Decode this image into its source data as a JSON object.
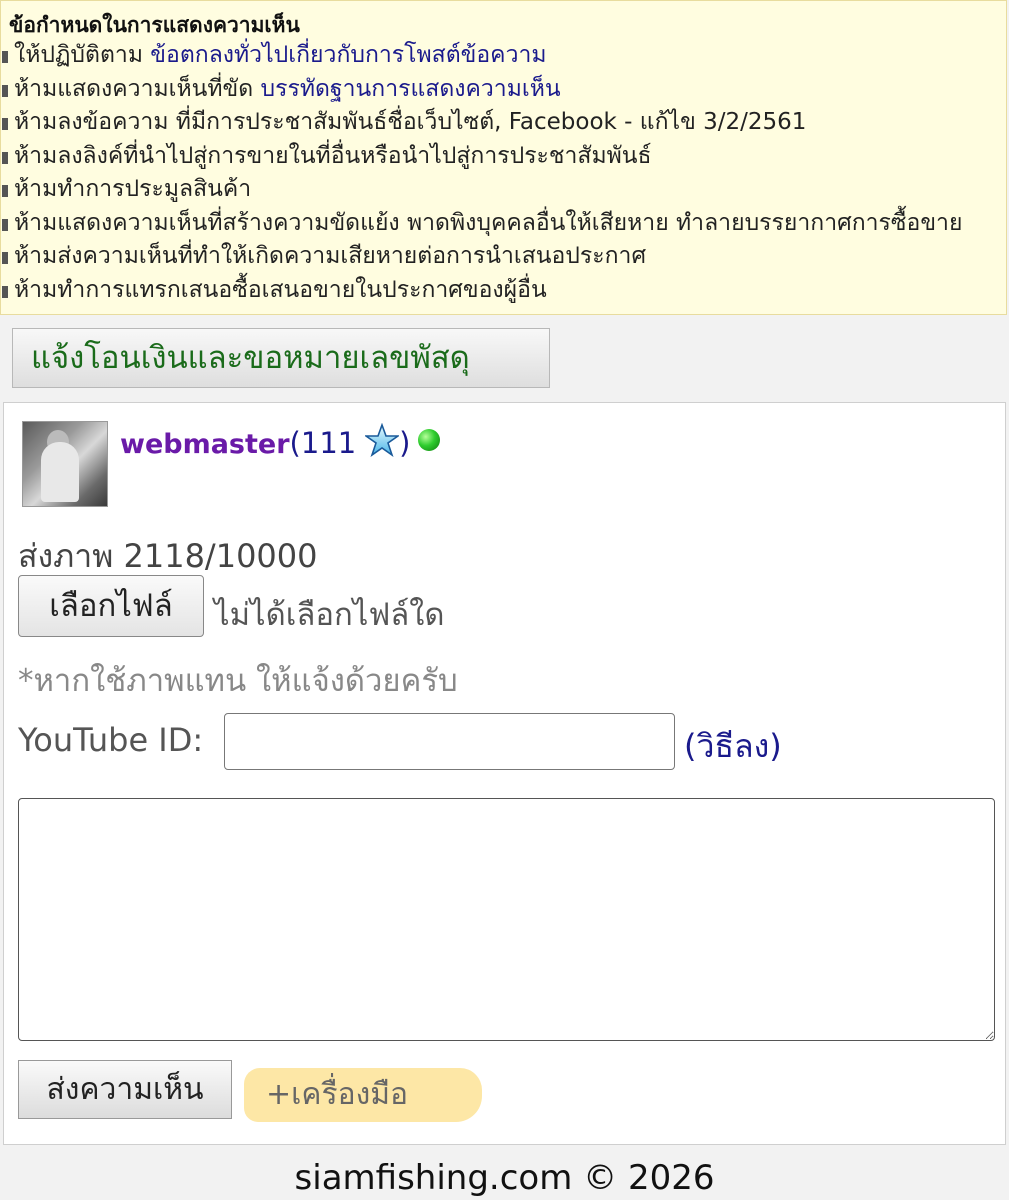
{
  "rules": {
    "title": "ข้อกำหนดในการแสดงความเห็น",
    "items": [
      {
        "text": "ให้ปฏิบัติตาม ",
        "link": "ข้อตกลงทั่วไปเกี่ยวกับการโพสต์ข้อความ"
      },
      {
        "text": "ห้ามแสดงความเห็นที่ขัด ",
        "link": "บรรทัดฐานการแสดงความเห็น"
      },
      {
        "text": "ห้ามลงข้อความ ที่มีการประชาสัมพันธ์ชื่อเว็บไซต์, Facebook - แก้ไข 3/2/2561",
        "link": ""
      },
      {
        "text": "ห้ามลงลิงค์ที่นำไปสู่การขายในที่อื่นหรือนำไปสู่การประชาสัมพันธ์",
        "link": ""
      },
      {
        "text": "ห้ามทำการประมูลสินค้า",
        "link": ""
      },
      {
        "text": "ห้ามแสดงความเห็นที่สร้างความขัดแย้ง พาดพิงบุคคลอื่นให้เสียหาย ทำลายบรรยากาศการซื้อขาย",
        "link": ""
      },
      {
        "text": "ห้ามส่งความเห็นที่ทำให้เกิดความเสียหายต่อการนำเสนอประกาศ",
        "link": ""
      },
      {
        "text": "ห้ามทำการแทรกเสนอซื้อเสนอขายในประกาศของผู้อื่น",
        "link": ""
      }
    ]
  },
  "transfer_button": "แจ้งโอนเงินและขอหมายเลขพัสดุ",
  "user": {
    "name": "webmaster",
    "open_paren": "(",
    "points": "111",
    "close_paren": ")",
    "star_icon": "star-icon",
    "online_icon": "online-status-icon"
  },
  "upload": {
    "label": "ส่งภาพ 2118/10000",
    "choose_button": "เลือกไฟล์",
    "status": "ไม่ได้เลือกไฟล์ใด",
    "note": "*หากใช้ภาพแทน ให้แจ้งด้วยครับ"
  },
  "youtube": {
    "label": "YouTube ID:",
    "value": "",
    "howto": "(วิธีลง)"
  },
  "comment": {
    "value": ""
  },
  "submit_button": "ส่งความเห็น",
  "tools_button": "+เครื่องมือ",
  "footer": "siamfishing.com © 2026"
}
